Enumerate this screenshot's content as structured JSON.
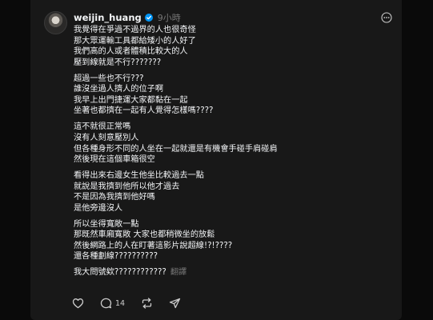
{
  "post": {
    "username": "weijin_huang",
    "time": "9小時",
    "paragraphs": [
      [
        "我覺得在爭過不過界的人也很奇怪",
        "那大眾運輸工具都給矮小的人好了",
        "我們高的人或者體積比較大的人",
        "壓到線就是不行???????"
      ],
      [
        "超過一些也不行???",
        "誰沒坐過人擠人的位子啊",
        "我早上出門捷運大家都黏在一起",
        "坐著也都擠在一起有人覺得怎樣嗎????"
      ],
      [
        "這不就很正常嗎",
        "沒有人刻意壓別人",
        "但各種身形不同的人坐在一起就還是有機會手碰手肩碰肩",
        "然後現在這個車箱很空"
      ],
      [
        "看得出來右邊女生他坐比較過去一點",
        "就說是我擠到他所以他才過去",
        "不是因為我擠到他好嗎",
        "是他旁邊沒人"
      ],
      [
        "所以坐得寬敞一點",
        "那既然車廂寬敞 大家也都稍微坐的放鬆",
        "然後網路上的人在盯著這影片說超線!?!????",
        "還各種劃線??????????"
      ]
    ],
    "last_line": "我大問號欸????????????",
    "translate_label": "翻譯",
    "reply_count": "14"
  },
  "icons": {
    "verified": "verified-badge-icon",
    "more": "more-options-icon",
    "like": "heart-icon",
    "reply": "comment-icon",
    "repost": "repost-icon",
    "share": "share-icon"
  },
  "colors": {
    "background": "#0a0a0a",
    "card": "#181818",
    "text": "#f3f5f7",
    "muted": "#777777",
    "verified": "#0095f6"
  }
}
